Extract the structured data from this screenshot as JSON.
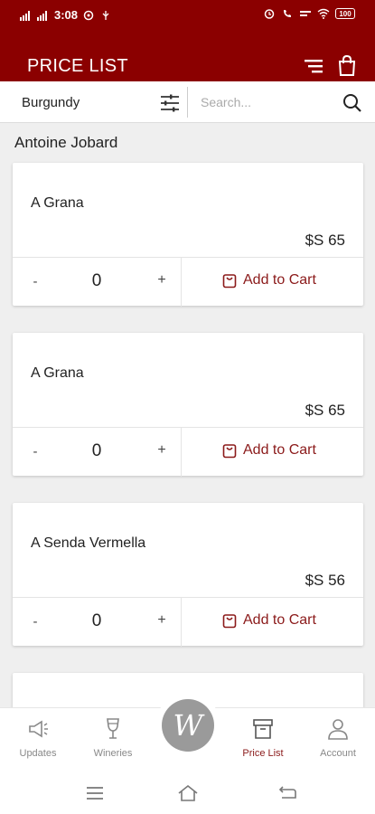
{
  "status_bar": {
    "time": "3:08",
    "battery": "100"
  },
  "header": {
    "title": "PRICE LIST"
  },
  "filter": {
    "region": "Burgundy",
    "search_placeholder": "Search..."
  },
  "producer": "Antoine Jobard",
  "products": [
    {
      "name": "A Grana",
      "price": "$S 65",
      "quantity": "0",
      "minus": "-",
      "plus": "+",
      "add_label": "Add to Cart"
    },
    {
      "name": "A Grana",
      "price": "$S 65",
      "quantity": "0",
      "minus": "-",
      "plus": "+",
      "add_label": "Add to Cart"
    },
    {
      "name": "A Senda Vermella",
      "price": "$S 56",
      "quantity": "0",
      "minus": "-",
      "plus": "+",
      "add_label": "Add to Cart"
    }
  ],
  "bottom_nav": {
    "items": [
      {
        "label": "Updates",
        "icon": "megaphone-icon"
      },
      {
        "label": "Wineries",
        "icon": "wine-glass-icon"
      },
      {
        "label": "Price List",
        "icon": "archive-icon",
        "active": true
      },
      {
        "label": "Account",
        "icon": "user-icon"
      }
    ],
    "logo_letter": "W"
  },
  "colors": {
    "brand": "#8b0000",
    "accent": "#8b1a1a",
    "background": "#efefef"
  }
}
